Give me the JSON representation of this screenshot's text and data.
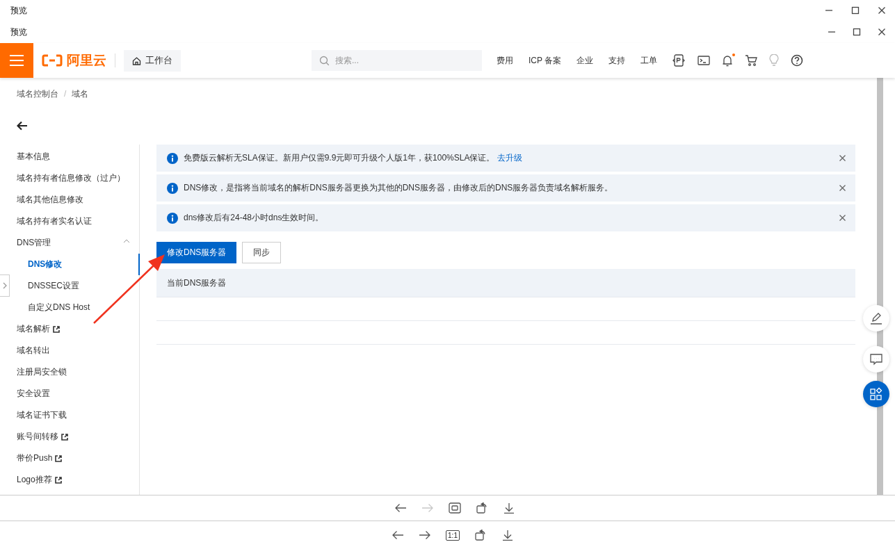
{
  "outer_window": {
    "title": "预览"
  },
  "inner_window": {
    "title": "预览"
  },
  "header": {
    "logo_text": "阿里云",
    "workbench": "工作台",
    "search": {
      "placeholder": "搜索..."
    },
    "links": [
      "费用",
      "ICP 备案",
      "企业",
      "支持",
      "工单"
    ],
    "notification_dot": true
  },
  "breadcrumb": [
    "域名控制台",
    "/",
    "域名"
  ],
  "sidebar": {
    "items": [
      {
        "label": "基本信息",
        "selected": false,
        "external": false
      },
      {
        "label": "域名持有者信息修改（过户）",
        "selected": false,
        "external": false
      },
      {
        "label": "域名其他信息修改",
        "selected": false,
        "external": false
      },
      {
        "label": "域名持有者实名认证",
        "selected": false,
        "external": false
      },
      {
        "label": "DNS管理",
        "selected": false,
        "external": false,
        "expanded": true,
        "children": [
          {
            "label": "DNS修改",
            "selected": true,
            "external": false
          },
          {
            "label": "DNSSEC设置",
            "selected": false,
            "external": false
          },
          {
            "label": "自定义DNS Host",
            "selected": false,
            "external": false
          }
        ]
      },
      {
        "label": "域名解析",
        "selected": false,
        "external": true
      },
      {
        "label": "域名转出",
        "selected": false,
        "external": false
      },
      {
        "label": "注册局安全锁",
        "selected": false,
        "external": false
      },
      {
        "label": "安全设置",
        "selected": false,
        "external": false
      },
      {
        "label": "域名证书下载",
        "selected": false,
        "external": false
      },
      {
        "label": "账号间转移",
        "selected": false,
        "external": true
      },
      {
        "label": "带价Push",
        "selected": false,
        "external": true
      },
      {
        "label": "Logo推荐",
        "selected": false,
        "external": true
      }
    ]
  },
  "alerts": [
    {
      "text": "免费版云解析无SLA保证。新用户仅需9.9元即可升级个人版1年，获100%SLA保证。",
      "link": "去升级"
    },
    {
      "text": "DNS修改，是指将当前域名的解析DNS服务器更换为其他的DNS服务器，由修改后的DNS服务器负责域名解析服务。"
    },
    {
      "text": "dns修改后有24-48小时dns生效时间。"
    }
  ],
  "buttons": [
    {
      "label": "修改DNS服务器",
      "kind": "primary"
    },
    {
      "label": "同步",
      "kind": "default"
    }
  ],
  "table": {
    "columns": [
      "当前DNS服务器"
    ]
  },
  "annotation": {
    "kind": "arrow"
  },
  "inner_toolbar": [
    {
      "kind": "back",
      "disabled": false
    },
    {
      "kind": "forward",
      "disabled": true
    },
    {
      "kind": "fit",
      "disabled": false
    },
    {
      "kind": "rotate",
      "disabled": false
    },
    {
      "kind": "download",
      "disabled": false
    }
  ],
  "outer_toolbar": [
    {
      "kind": "back",
      "disabled": false
    },
    {
      "kind": "forward",
      "disabled": false
    },
    {
      "kind": "actual-size",
      "label": "1:1",
      "disabled": false
    },
    {
      "kind": "rotate",
      "disabled": false
    },
    {
      "kind": "download",
      "disabled": false
    }
  ]
}
